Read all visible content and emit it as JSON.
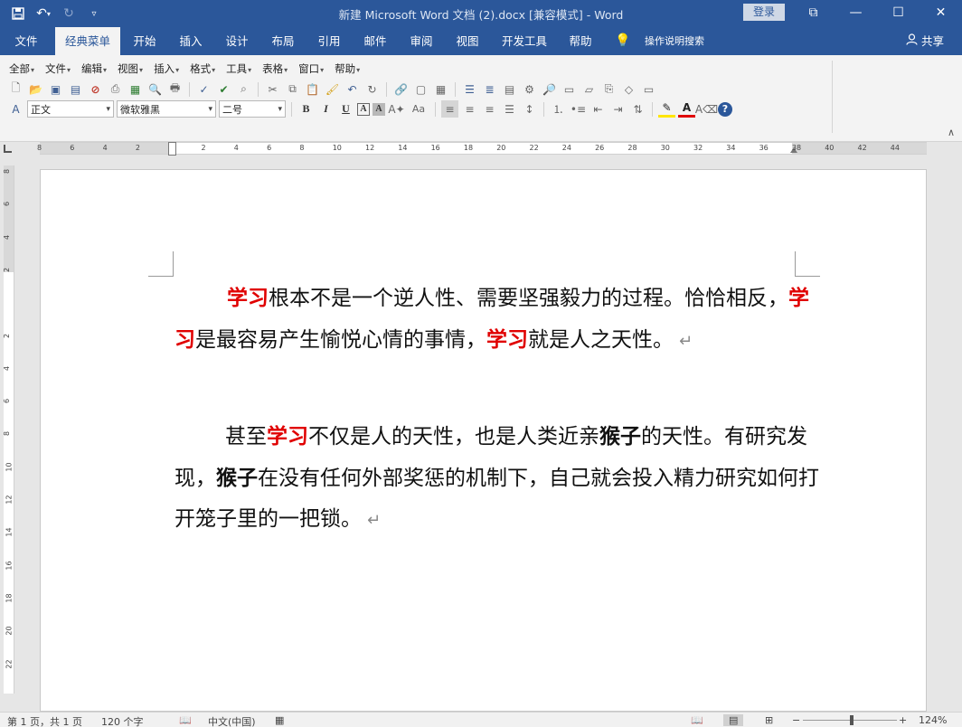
{
  "window": {
    "title": "新建 Microsoft Word 文档 (2).docx [兼容模式]  -  Word",
    "login_label": "登录",
    "controls": [
      "⧉",
      "—",
      "☐",
      "✕"
    ]
  },
  "tabs": [
    {
      "label": "文件"
    },
    {
      "label": "经典菜单",
      "active": true
    },
    {
      "label": "开始"
    },
    {
      "label": "插入"
    },
    {
      "label": "设计"
    },
    {
      "label": "布局"
    },
    {
      "label": "引用"
    },
    {
      "label": "邮件"
    },
    {
      "label": "审阅"
    },
    {
      "label": "视图"
    },
    {
      "label": "开发工具"
    },
    {
      "label": "帮助"
    },
    {
      "label": "操作说明搜索"
    }
  ],
  "share_label": "共享",
  "classic_menu": [
    "全部",
    "文件",
    "编辑",
    "视图",
    "插入",
    "格式",
    "工具",
    "表格",
    "窗口",
    "帮助"
  ],
  "font": {
    "style": "正文",
    "family": "微软雅黑",
    "size": "二号"
  },
  "format_buttons": {
    "bold": "B",
    "italic": "I",
    "underline": "U",
    "char_border": "A",
    "char_shade": "A",
    "change_case": "Aa"
  },
  "accent_colors": {
    "title_bar": "#2b579a",
    "highlight_red": "#e00000"
  },
  "document": {
    "paragraphs": [
      [
        {
          "text": "学习",
          "style": "red"
        },
        {
          "text": "根本不是一个逆人性、需要坚强毅力的过程。恰恰相反，",
          "style": "normal"
        },
        {
          "text": "学习",
          "style": "red"
        },
        {
          "text": "是最容易产生愉悦心情的事情，",
          "style": "normal"
        },
        {
          "text": "学习",
          "style": "red"
        },
        {
          "text": "就是人之天性。",
          "style": "normal"
        }
      ],
      [
        {
          "text": "甚至",
          "style": "normal"
        },
        {
          "text": "学习",
          "style": "red"
        },
        {
          "text": "不仅是人的天性，也是人类近亲",
          "style": "normal"
        },
        {
          "text": "猴子",
          "style": "bold"
        },
        {
          "text": "的天性。有研究发现，",
          "style": "normal"
        },
        {
          "text": "猴子",
          "style": "bold"
        },
        {
          "text": "在没有任何外部奖惩的机制下，自己就会投入精力研究如何打开笼子里的一把锁。",
          "style": "normal"
        }
      ]
    ]
  },
  "statusbar": {
    "page": "第 1 页，共 1 页",
    "words": "120 个字",
    "language": "中文(中国)",
    "zoom": "124%"
  }
}
